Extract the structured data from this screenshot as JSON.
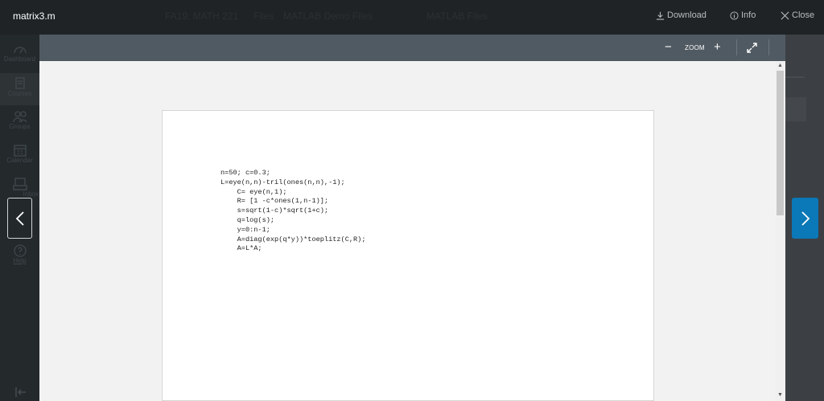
{
  "header": {
    "filename": "matrix3.m",
    "background_text": [
      "FA19: MATH 221",
      "Files",
      "MATLAB Demo Files",
      "MATLAB Files"
    ],
    "download_label": "Download",
    "info_label": "Info",
    "close_label": "Close"
  },
  "sidebar": {
    "items": [
      {
        "label": "Dashboard",
        "icon": "dashboard-icon"
      },
      {
        "label": "Courses",
        "icon": "courses-icon"
      },
      {
        "label": "Groups",
        "icon": "groups-icon"
      },
      {
        "label": "Calendar",
        "icon": "calendar-icon"
      },
      {
        "label": "Inbox",
        "icon": "inbox-icon"
      },
      {
        "label": "Help",
        "icon": "help-icon"
      }
    ],
    "active_index": 1
  },
  "toolbar": {
    "zoom_label": "ZOOM",
    "zoom_out": "−",
    "zoom_in": "+"
  },
  "document": {
    "code_lines": [
      "n=50; c=0.3;",
      "L=eye(n,n)-tril(ones(n,n),-1);",
      "    C= eye(n,1);",
      "    R= [1 -c*ones(1,n-1)];",
      "    s=sqrt(1-c)*sqrt(1+c);",
      "    q=log(s);",
      "    y=0:n-1;",
      "    A=diag(exp(q*y))*toeplitz(C,R);",
      "    A=L*A;"
    ]
  },
  "colors": {
    "topbar_bg": "#1f2326",
    "toolbar_bg": "#505a62",
    "next_button_bg": "#0b78b7",
    "viewer_bg": "#f2f2f2"
  }
}
